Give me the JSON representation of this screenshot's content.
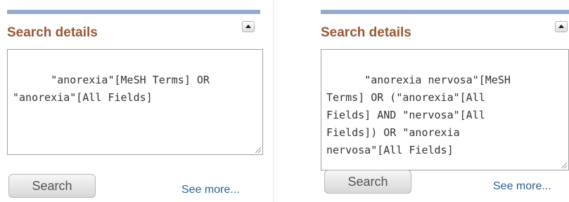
{
  "panels": [
    {
      "title": "Search details",
      "query": "\"anorexia\"[MeSH Terms] OR\n\"anorexia\"[All Fields]",
      "search_label": "Search",
      "see_more_label": "See more..."
    },
    {
      "title": "Search details",
      "query": "\"anorexia nervosa\"[MeSH\nTerms] OR (\"anorexia\"[All\nFields] AND \"nervosa\"[All\nFields]) OR \"anorexia\nnervosa\"[All Fields]",
      "search_label": "Search",
      "see_more_label": "See more..."
    }
  ],
  "icons": {
    "collapse": "collapse-up-icon",
    "resize": "resize-grip-icon"
  },
  "colors": {
    "header_bar": "#95aac4",
    "title": "#985735",
    "link": "#2c5e95"
  }
}
